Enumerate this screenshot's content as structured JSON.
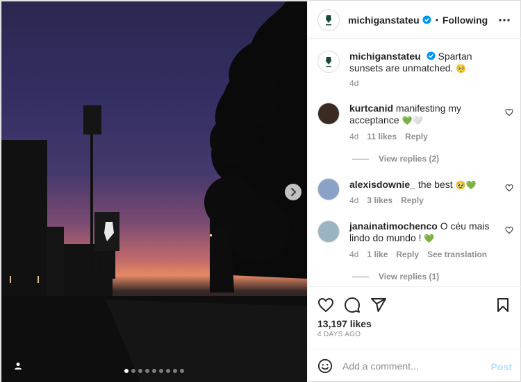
{
  "post": {
    "username": "michiganstateu",
    "follow_status": "Following",
    "separator": "•",
    "caption_text": "Spartan sunsets are unmatched.",
    "caption_emoji": "🥺",
    "caption_time": "4d",
    "likes": "13,197 likes",
    "date": "4 DAYS AGO"
  },
  "comments": [
    {
      "username": "kurtcanid",
      "text": "manifesting my acceptance",
      "emoji": "💚🤍",
      "time": "4d",
      "likes": "11 likes",
      "reply": "Reply",
      "view_replies": "View replies (2)"
    },
    {
      "username": "alexisdownie_",
      "text": "the best",
      "emoji": "🥹💚",
      "time": "4d",
      "likes": "3 likes",
      "reply": "Reply"
    },
    {
      "username": "janainatimochenco",
      "text": "O céu mais lindo do mundo !",
      "emoji": "💚",
      "time": "4d",
      "likes": "1 like",
      "reply": "Reply",
      "translation": "See translation",
      "view_replies": "View replies (1)"
    }
  ],
  "add_comment": {
    "placeholder": "Add a comment...",
    "post_label": "Post"
  },
  "carousel": {
    "total": 9,
    "current": 1
  },
  "icons": {
    "more": "more-horizontal-icon",
    "heart": "heart-icon",
    "comment": "comment-icon",
    "share": "share-icon",
    "save": "bookmark-icon",
    "emoji": "emoji-icon",
    "next": "chevron-right-icon",
    "user_tag": "user-tag-icon",
    "verified": "verified-badge-icon"
  },
  "colors": {
    "verified": "#0095f6",
    "post_disabled": "#b2dffc",
    "muted": "#8e8e8e",
    "spartan_green": "#18453b"
  }
}
